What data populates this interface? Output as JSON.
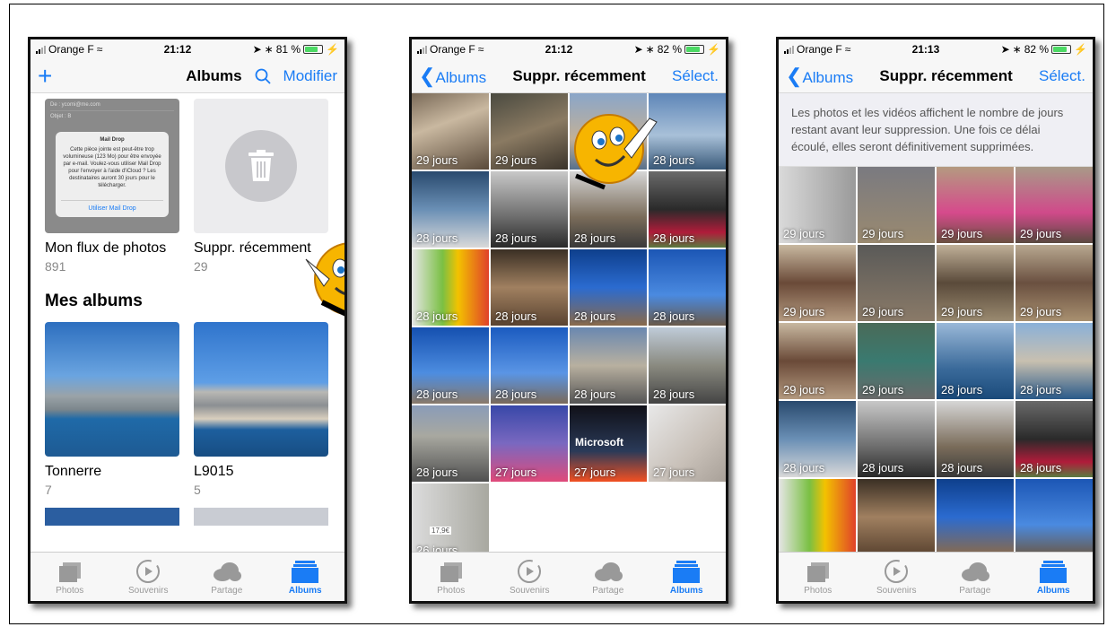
{
  "status": {
    "carrier": "Orange F",
    "p1": {
      "time": "21:12",
      "battery": "81 %"
    },
    "p2": {
      "time": "21:12",
      "battery": "82 %"
    },
    "p3": {
      "time": "21:13",
      "battery": "82 %"
    }
  },
  "screen1": {
    "add_label": "+",
    "title": "Albums",
    "edit_label": "Modifier",
    "mail_drop": {
      "from": "De : ycomi@me.com",
      "object": "Objet : B",
      "heading": "Mail Drop",
      "body": "Cette pièce jointe est peut-être trop volumineuse (123 Mo) pour être envoyée par e-mail. Voulez-vous utiliser Mail Drop pour l'envoyer à l'aide d'iCloud ? Les destinataires auront 30 jours pour le télécharger.",
      "action": "Utiliser Mail Drop"
    },
    "top_albums": [
      {
        "name": "Mon flux de photos",
        "count": "891"
      },
      {
        "name": "Suppr. récemment",
        "count": "29"
      }
    ],
    "section_title": "Mes albums",
    "my_albums": [
      {
        "name": "Tonnerre",
        "count": "7"
      },
      {
        "name": "L9015",
        "count": "5"
      }
    ]
  },
  "screen2": {
    "back_label": "Albums",
    "title": "Suppr. récemment",
    "select_label": "Sélect.",
    "cells": [
      "29 jours",
      "29 jours",
      "",
      "28 jours",
      "28 jours",
      "28 jours",
      "28 jours",
      "28 jours",
      "28 jours",
      "28 jours",
      "28 jours",
      "28 jours",
      "28 jours",
      "28 jours",
      "28 jours",
      "28 jours",
      "28 jours",
      "27 jours",
      "27 jours",
      "27 jours",
      "26 jours"
    ],
    "microsoft": "Microsoft",
    "price": "17,9€"
  },
  "screen3": {
    "back_label": "Albums",
    "title": "Suppr. récemment",
    "select_label": "Sélect.",
    "info": "Les photos et les vidéos affichent le nombre de jours restant avant leur suppression. Une fois ce délai écoulé, elles seront définitivement supprimées.",
    "cells": [
      "29 jours",
      "29 jours",
      "29 jours",
      "29 jours",
      "29 jours",
      "29 jours",
      "29 jours",
      "29 jours",
      "29 jours",
      "29 jours",
      "28 jours",
      "28 jours",
      "28 jours",
      "28 jours",
      "28 jours",
      "28 jours",
      "",
      "",
      "",
      ""
    ]
  },
  "tabs": [
    {
      "label": "Photos",
      "icon": "photos-icon"
    },
    {
      "label": "Souvenirs",
      "icon": "memories-icon"
    },
    {
      "label": "Partage",
      "icon": "cloud-icon"
    },
    {
      "label": "Albums",
      "icon": "albums-icon"
    }
  ],
  "colors": {
    "accent": "#1a7cf5",
    "battery": "#4cd964",
    "smiley": "#f7b500"
  }
}
